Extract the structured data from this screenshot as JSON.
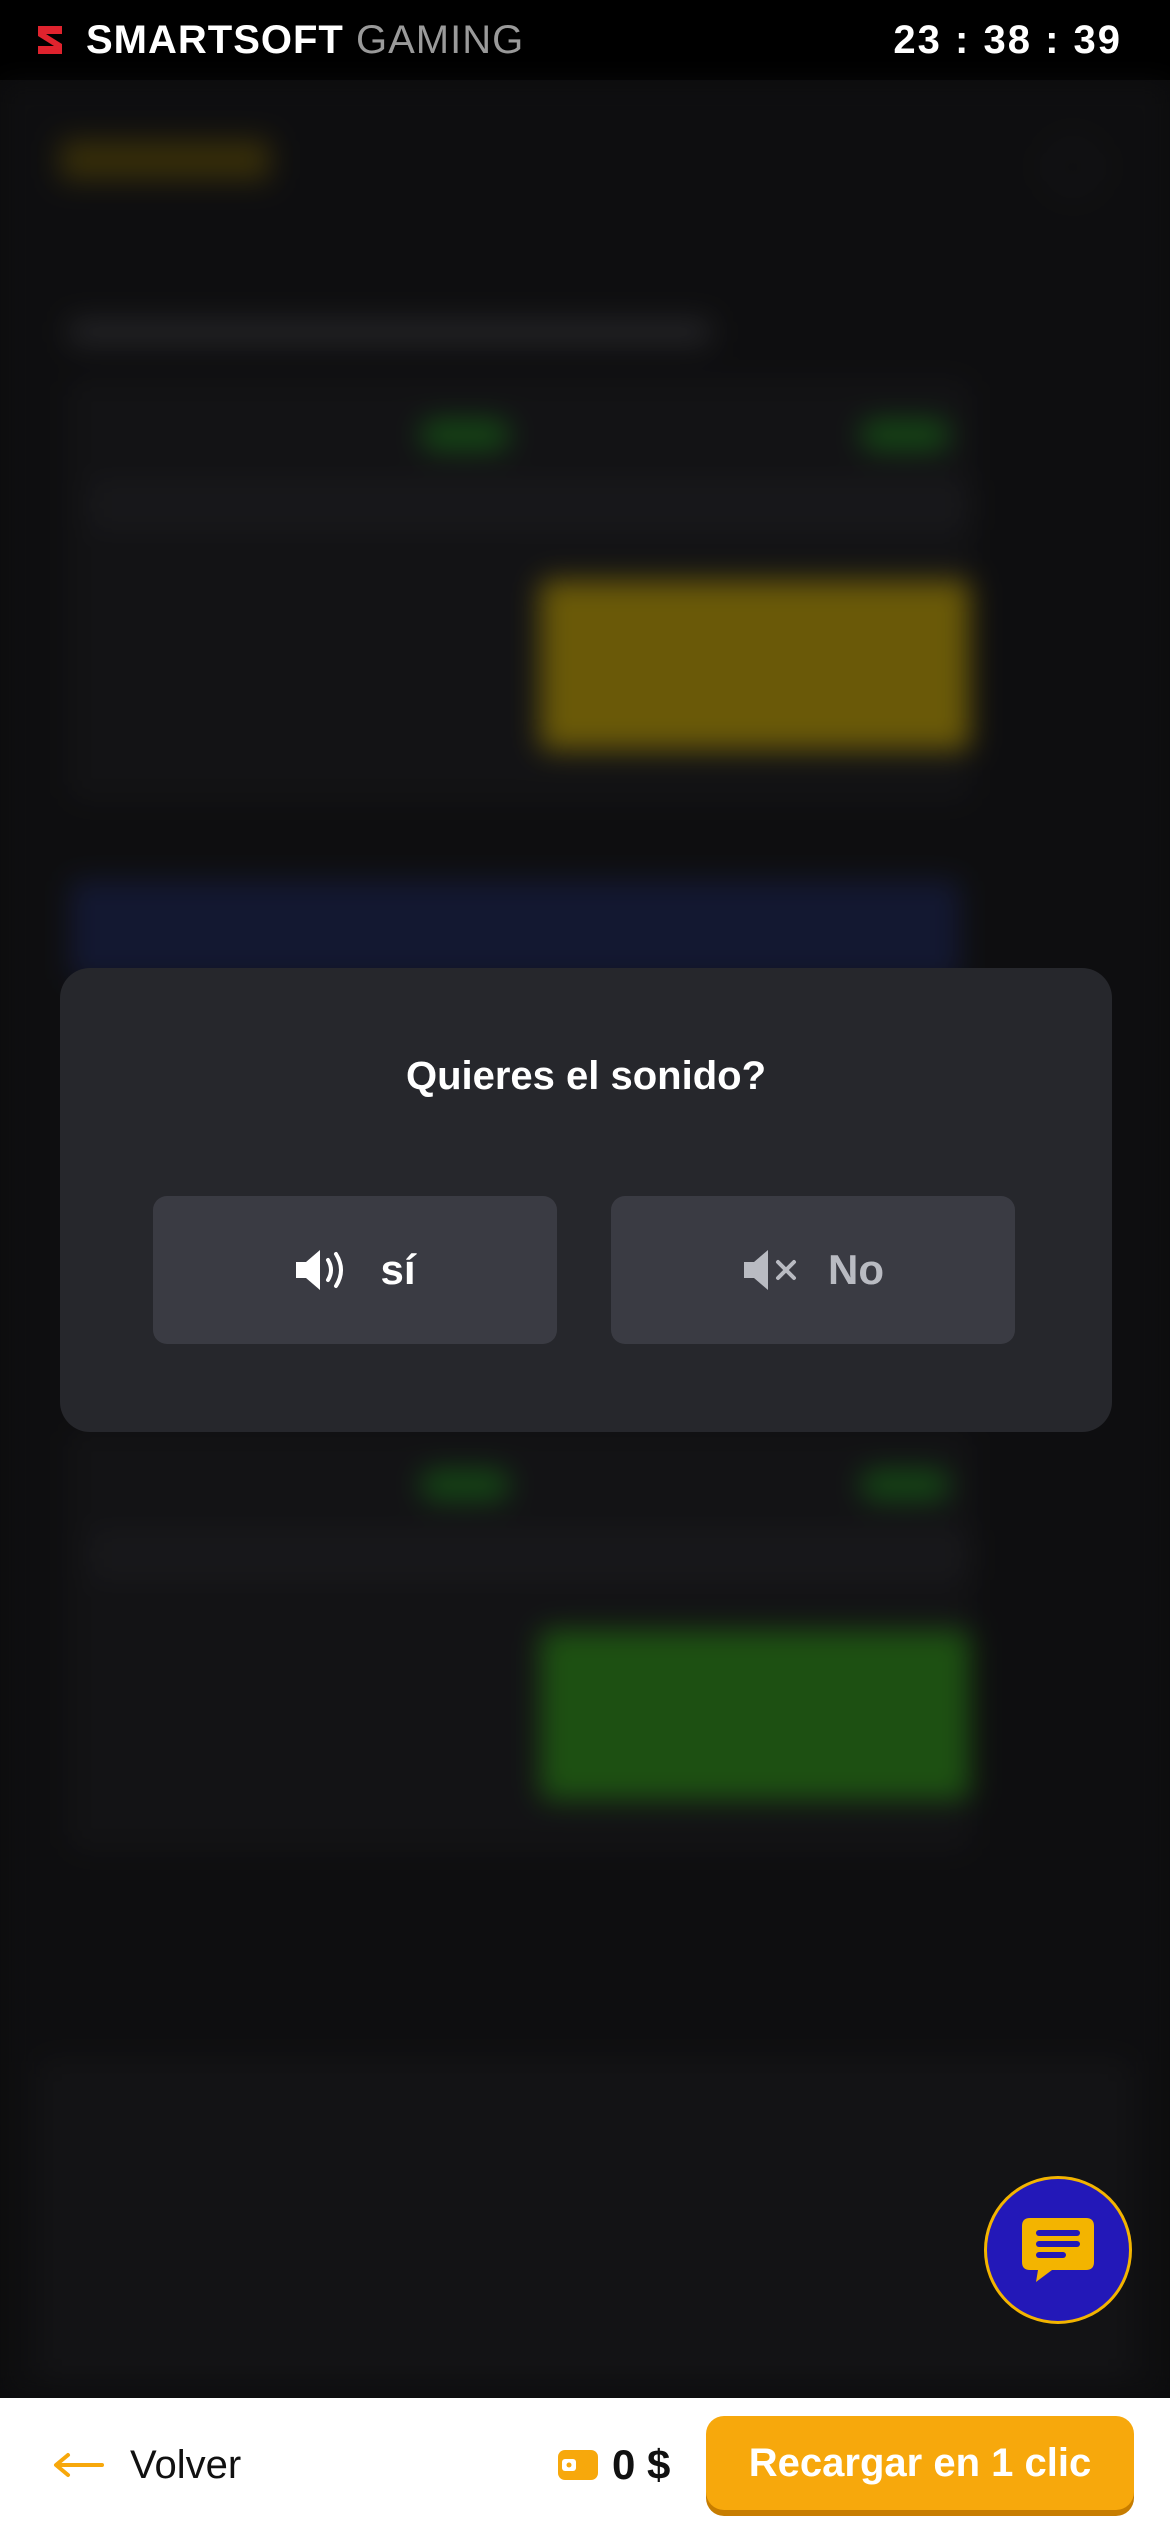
{
  "header": {
    "brand_bold": "SMARTSOFT",
    "brand_light": "GAMING",
    "clock": "23 : 38 : 39"
  },
  "dialog": {
    "title": "Quieres el sonido?",
    "yes_label": "sí",
    "no_label": "No"
  },
  "footer": {
    "back_label": "Volver",
    "balance": "0 $",
    "recharge_label": "Recargar en 1 clic"
  },
  "colors": {
    "accent": "#f7a80c",
    "chat_fab": "#2318b8",
    "brand_red": "#e0232e"
  },
  "icons": {
    "brand": "smartsoft-logo",
    "yes": "speaker-on-icon",
    "no": "speaker-muted-icon",
    "back": "arrow-left-icon",
    "balance": "wallet-icon",
    "chat": "chat-icon"
  }
}
